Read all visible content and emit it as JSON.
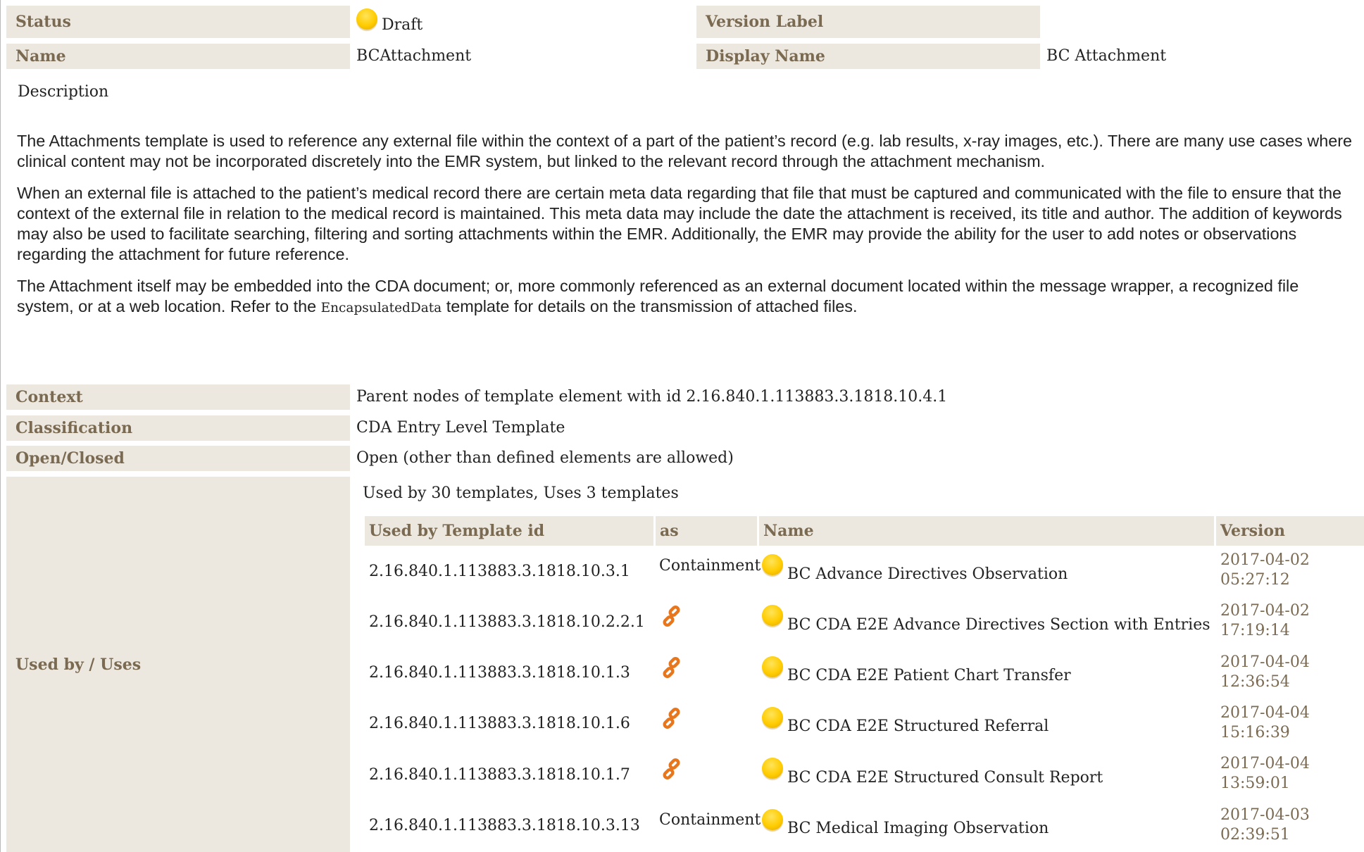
{
  "properties": {
    "status": {
      "label": "Status",
      "value": "Draft",
      "icon": "draft-status-dot",
      "icon_color": "#ffcc00"
    },
    "version_label": {
      "label": "Version Label",
      "value": ""
    },
    "name": {
      "label": "Name",
      "value": "BCAttachment"
    },
    "display_name": {
      "label": "Display Name",
      "value": "BC Attachment"
    }
  },
  "description": {
    "heading": "Description",
    "p1": "The Attachments template is used to reference any external file within the context of a part of the patient’s record (e.g. lab results, x-ray images, etc.). There are many use cases where clinical content may not be incorporated discretely into the EMR system, but linked to the relevant record through the attachment mechanism.",
    "p2": "When an external file is attached to the patient’s medical record there are certain meta data regarding that file that must be captured and communicated with the file to ensure that the context of the external file in relation to the medical record is maintained. This meta data may include the date the attachment is  received, its title and author. The addition of keywords may also be used to facilitate searching, filtering and sorting attachments within the EMR. Additionally, the EMR may provide the ability for the user to add notes or observations regarding the attachment for future reference.",
    "p3_before": "The Attachment itself may be embedded into the CDA document; or, more commonly referenced as an external document located within the message wrapper, a recognized file system, or at a web location. Refer to the ",
    "p3_code": "EncapsulatedData",
    "p3_after": " template for details on the transmission of attached files."
  },
  "context": {
    "label": "Context",
    "value": "Parent nodes of template element with id 2.16.840.1.113883.3.1818.10.4.1"
  },
  "classification": {
    "label": "Classification",
    "value": "CDA Entry Level Template"
  },
  "open_closed": {
    "label": "Open/Closed",
    "value": "Open (other than defined elements are allowed)"
  },
  "used_by": {
    "label": "Used by / Uses",
    "summary": "Used by 30 templates, Uses 3 templates",
    "headers": {
      "id": "Used by Template id",
      "as": "as",
      "name": "Name",
      "version": "Version"
    },
    "rows": [
      {
        "id": "2.16.840.1.113883.3.1818.10.3.1",
        "as": "Containment",
        "as_icon": "",
        "name": "BC Advance Directives Observation",
        "date": "2017-04-02",
        "time": "05:27:12"
      },
      {
        "id": "2.16.840.1.113883.3.1818.10.2.2.1",
        "as": "",
        "as_icon": "link-icon",
        "name": "BC CDA E2E Advance Directives Section with Entries",
        "date": "2017-04-02",
        "time": "17:19:14"
      },
      {
        "id": "2.16.840.1.113883.3.1818.10.1.3",
        "as": "",
        "as_icon": "link-icon",
        "name": "BC CDA E2E Patient Chart Transfer",
        "date": "2017-04-04",
        "time": "12:36:54"
      },
      {
        "id": "2.16.840.1.113883.3.1818.10.1.6",
        "as": "",
        "as_icon": "link-icon",
        "name": "BC CDA E2E Structured Referral",
        "date": "2017-04-04",
        "time": "15:16:39"
      },
      {
        "id": "2.16.840.1.113883.3.1818.10.1.7",
        "as": "",
        "as_icon": "link-icon",
        "name": "BC CDA E2E Structured Consult Report",
        "date": "2017-04-04",
        "time": "13:59:01"
      },
      {
        "id": "2.16.840.1.113883.3.1818.10.3.13",
        "as": "Containment",
        "as_icon": "",
        "name": "BC Medical Imaging Observation",
        "date": "2017-04-03",
        "time": "02:39:51"
      }
    ]
  },
  "colors": {
    "label_bg": "#ede8df",
    "label_text": "#7a6a52",
    "status_dot": "#ffcc00",
    "link_icon": "#e8761c"
  }
}
